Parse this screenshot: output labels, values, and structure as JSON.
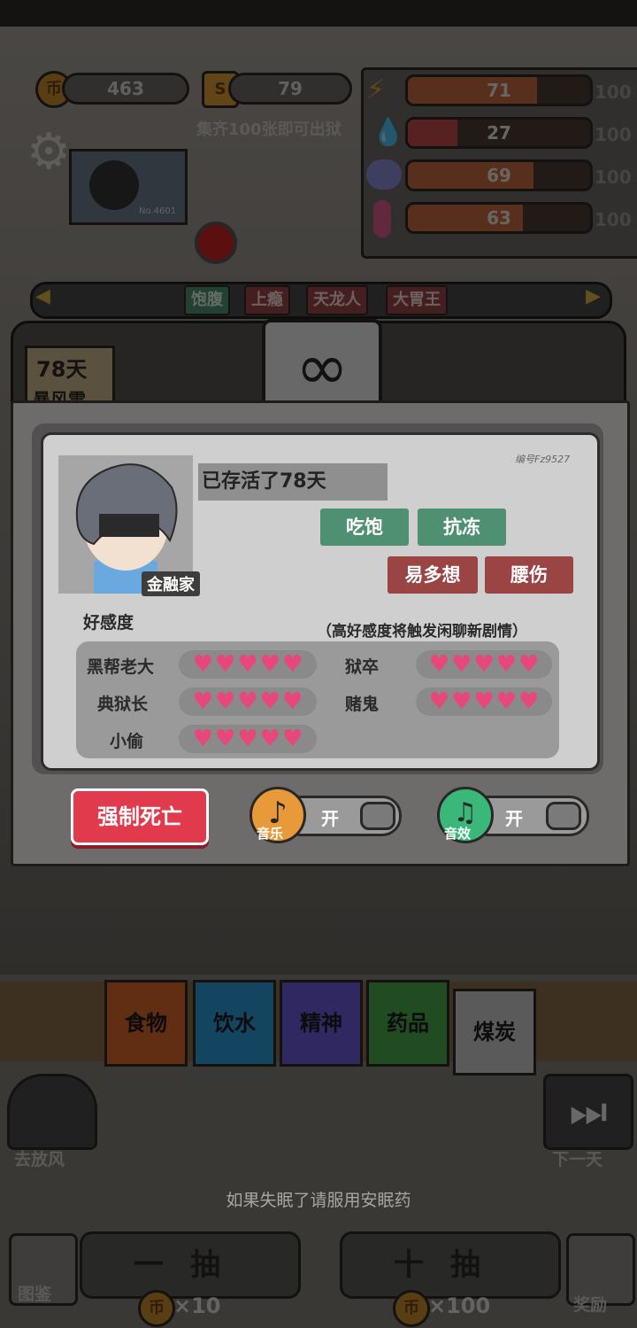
{
  "stats": {
    "coins": "463",
    "s_count": "79",
    "s_hint": "集齐100张即可出狱",
    "bars": [
      {
        "value": "71",
        "max": "100",
        "fill": 0.71,
        "color": "#c2693f",
        "icon": "lightning-icon"
      },
      {
        "value": "27",
        "max": "100",
        "fill": 0.27,
        "color": "#c24a4a",
        "icon": "water-drop-icon"
      },
      {
        "value": "69",
        "max": "100",
        "fill": 0.69,
        "color": "#c2693f",
        "icon": "brain-icon"
      },
      {
        "value": "63",
        "max": "100",
        "fill": 0.63,
        "color": "#c2693f",
        "icon": "thermometer-icon"
      }
    ]
  },
  "traits": [
    "饱腹",
    "上瘾",
    "天龙人",
    "大胃王"
  ],
  "day_sign": {
    "days": "78天",
    "weather": "暴风雪"
  },
  "profile": {
    "id": "编号Fz9527",
    "name": "金融家",
    "survived": "已存活了78天",
    "good_tags": [
      "吃饱",
      "抗冻"
    ],
    "bad_tags": [
      "易多想",
      "腰伤"
    ],
    "favor_title": "好感度",
    "favor_hint": "（高好感度将触发闲聊新剧情）",
    "favor": [
      {
        "name": "黑帮老大",
        "hearts": 5
      },
      {
        "name": "狱卒",
        "hearts": 5
      },
      {
        "name": "典狱长",
        "hearts": 5
      },
      {
        "name": "赌鬼",
        "hearts": 5
      },
      {
        "name": "小偷",
        "hearts": 5
      }
    ]
  },
  "controls": {
    "force_death": "强制死亡",
    "music_label": "音乐",
    "music_state": "开",
    "sfx_label": "音效",
    "sfx_state": "开"
  },
  "categories": [
    "食物",
    "饮水",
    "精神",
    "药品",
    "煤炭"
  ],
  "nav": {
    "left": "去放风",
    "right": "下一天"
  },
  "hint": "如果失眠了请服用安眠药",
  "draws": [
    {
      "label": "一抽",
      "cost": "×10"
    },
    {
      "label": "十抽",
      "cost": "×100"
    }
  ],
  "bottom": {
    "left": "图鉴",
    "right": "奖励",
    "coin_icon": "币"
  },
  "monitor_text": "No.4601",
  "colors": {
    "accent_red": "#e03a4c",
    "good_tag": "#4f8f72",
    "bad_tag": "#9a4444",
    "heart": "#e8477a"
  }
}
